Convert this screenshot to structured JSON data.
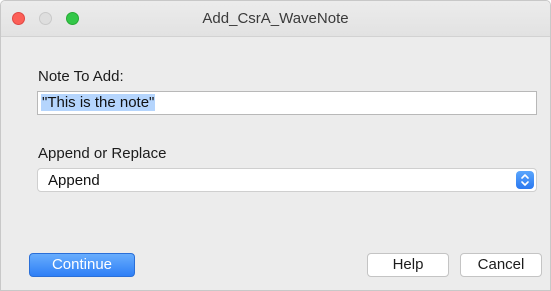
{
  "window": {
    "title": "Add_CsrA_WaveNote"
  },
  "form": {
    "note_label": "Note To Add:",
    "note_value": "\"This is the note\"",
    "mode_label": "Append or Replace",
    "mode_selected": "Append",
    "mode_icon": "up-down-chevron-icon"
  },
  "buttons": {
    "continue_label": "Continue",
    "help_label": "Help",
    "cancel_label": "Cancel"
  },
  "colors": {
    "accent": "#2e7ff6",
    "close": "#fc5f57",
    "zoom": "#33c748",
    "selection": "#b5d5fd"
  }
}
